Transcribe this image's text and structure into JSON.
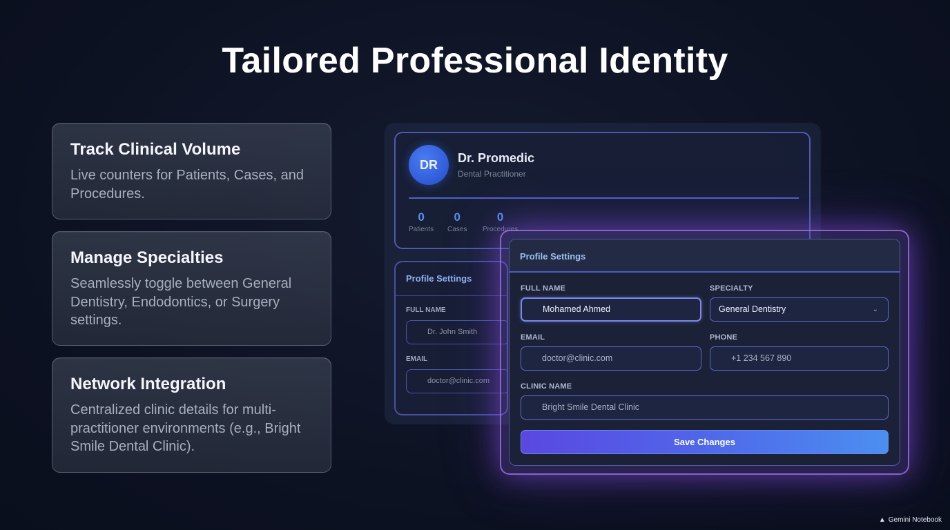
{
  "title": "Tailored Professional Identity",
  "features": [
    {
      "heading": "Track Clinical Volume",
      "text": "Live counters for Patients, Cases, and Procedures."
    },
    {
      "heading": "Manage Specialties",
      "text": "Seamlessly toggle between General Dentistry, Endodontics, or Surgery settings."
    },
    {
      "heading": "Network Integration",
      "text": "Centralized clinic details for multi-practitioner environments (e.g., Bright Smile Dental Clinic)."
    }
  ],
  "profile": {
    "avatar_initials": "DR",
    "name": "Dr. Promedic",
    "role": "Dental Practitioner",
    "stats": [
      {
        "value": "0",
        "label": "Patients"
      },
      {
        "value": "0",
        "label": "Cases"
      },
      {
        "value": "0",
        "label": "Procedures"
      }
    ]
  },
  "settings_back": {
    "header": "Profile Settings",
    "full_name_label": "FULL NAME",
    "full_name_value": "Dr. John Smith",
    "email_label": "EMAIL",
    "email_value": "doctor@clinic.com"
  },
  "settings": {
    "header": "Profile Settings",
    "full_name_label": "FULL NAME",
    "full_name_value": "Mohamed Ahmed",
    "specialty_label": "SPECIALTY",
    "specialty_value": "General Dentistry",
    "email_label": "EMAIL",
    "email_placeholder": "doctor@clinic.com",
    "phone_label": "PHONE",
    "phone_placeholder": "+1 234 567 890",
    "clinic_label": "CLINIC NAME",
    "clinic_placeholder": "Bright Smile Dental Clinic",
    "save_label": "Save Changes"
  },
  "watermark": "Gemini Notebook",
  "colors": {
    "accent": "#5b8df2",
    "glow": "#8c50e6",
    "button_start": "#5a48e0",
    "button_end": "#4b8ff0"
  }
}
